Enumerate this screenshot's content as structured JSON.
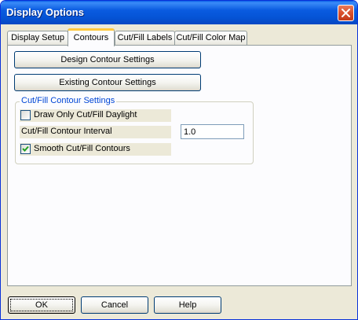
{
  "window": {
    "title": "Display Options"
  },
  "tabs": [
    {
      "label": "Display Setup",
      "active": false
    },
    {
      "label": "Contours",
      "active": true
    },
    {
      "label": "Cut/Fill Labels",
      "active": false
    },
    {
      "label": "Cut/Fill Color Map",
      "active": false
    }
  ],
  "panel": {
    "design_button": "Design Contour Settings",
    "existing_button": "Existing Contour Settings",
    "group": {
      "label": "Cut/Fill Contour Settings",
      "daylight": {
        "label": "Draw Only Cut/Fill Daylight",
        "checked": false
      },
      "interval": {
        "label": "Cut/Fill Contour Interval",
        "value": "1.0"
      },
      "smooth": {
        "label": "Smooth Cut/Fill Contours",
        "checked": true
      }
    }
  },
  "footer": {
    "ok": "OK",
    "cancel": "Cancel",
    "help": "Help"
  },
  "icons": {
    "close": "close-icon",
    "check": "checkmark-icon"
  },
  "colors": {
    "titlebar": "#0554D6",
    "close": "#D9502D",
    "tab_highlight": "#FFC83C",
    "group_label": "#0046D5"
  }
}
